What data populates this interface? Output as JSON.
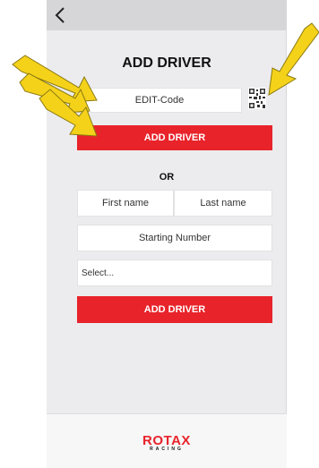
{
  "header": {
    "back_icon": "chevron-left-icon",
    "title": "ADD DRIVER"
  },
  "edit_code": {
    "placeholder": "EDIT-Code",
    "qr_icon": "qr-code-icon"
  },
  "add_driver_code_button": "ADD DRIVER",
  "divider_text": "OR",
  "manual_form": {
    "first_name_placeholder": "First name",
    "last_name_placeholder": "Last name",
    "starting_number_placeholder": "Starting Number",
    "select_placeholder": "Select...",
    "submit_label": "ADD DRIVER"
  },
  "brand": {
    "logo_text": "ROTAX",
    "logo_subtext": "RACING"
  },
  "colors": {
    "accent": "#e8232a",
    "annotation_arrow": "#f5d21a"
  }
}
